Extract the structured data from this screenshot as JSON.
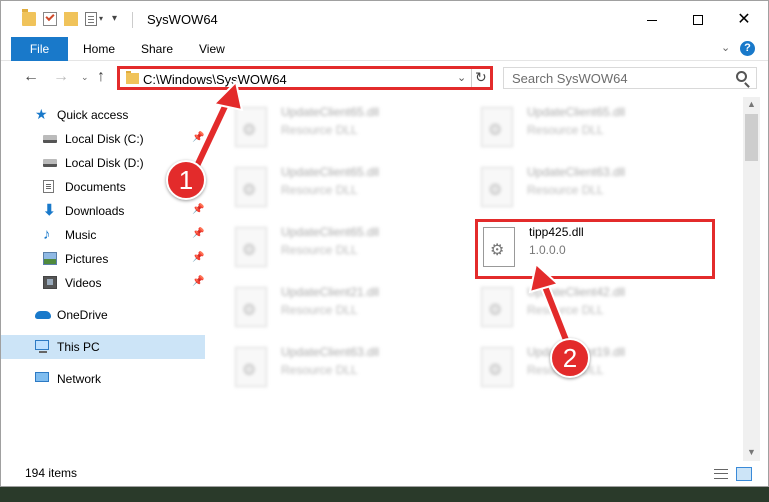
{
  "window": {
    "title": "SysWOW64",
    "minimize": "—",
    "maximize": "☐",
    "close": "✕"
  },
  "ribbon": {
    "tabs": [
      "File",
      "Home",
      "Share",
      "View"
    ],
    "help": "?"
  },
  "address": {
    "path": "C:\\Windows\\SysWOW64"
  },
  "search": {
    "placeholder": "Search SysWOW64"
  },
  "navpane": {
    "items": [
      {
        "label": "Quick access",
        "icon": "star-icon",
        "pinned": false
      },
      {
        "label": "Local Disk (C:)",
        "icon": "drive-icon",
        "pinned": true
      },
      {
        "label": "Local Disk (D:)",
        "icon": "drive-icon",
        "pinned": false
      },
      {
        "label": "Documents",
        "icon": "documents-icon",
        "pinned": true
      },
      {
        "label": "Downloads",
        "icon": "download-icon",
        "pinned": true
      },
      {
        "label": "Music",
        "icon": "music-icon",
        "pinned": true
      },
      {
        "label": "Pictures",
        "icon": "pictures-icon",
        "pinned": true
      },
      {
        "label": "Videos",
        "icon": "videos-icon",
        "pinned": true
      },
      {
        "label": "OneDrive",
        "icon": "cloud-icon",
        "pinned": false
      },
      {
        "label": "This PC",
        "icon": "computer-icon",
        "pinned": false
      },
      {
        "label": "Network",
        "icon": "network-icon",
        "pinned": false
      }
    ]
  },
  "files": [
    {
      "name": "UpdateClient65.dll",
      "type": "Resource DLL"
    },
    {
      "name": "UpdateClient65.dll",
      "type": "Resource DLL"
    },
    {
      "name": "UpdateClient65.dll",
      "type": "Resource DLL"
    },
    {
      "name": "UpdateClient63.dll",
      "type": "Resource DLL"
    },
    {
      "name": "UpdateClient65.dll",
      "type": "Resource DLL"
    },
    {
      "name": "tipp425.dll",
      "type": "1.0.0.0"
    },
    {
      "name": "UpdateClient21.dll",
      "type": "Resource DLL"
    },
    {
      "name": "UpdateClient42.dll",
      "type": "Resource DLL"
    },
    {
      "name": "UpdateClient63.dll",
      "type": "Resource DLL"
    },
    {
      "name": "UpdateClient19.dll",
      "type": "Resource DLL"
    }
  ],
  "status": {
    "item_count": "194 items"
  },
  "callouts": [
    "1",
    "2"
  ],
  "colors": {
    "accent": "#1979ca",
    "highlight": "#e32b2b",
    "selection": "#cce4f7"
  }
}
